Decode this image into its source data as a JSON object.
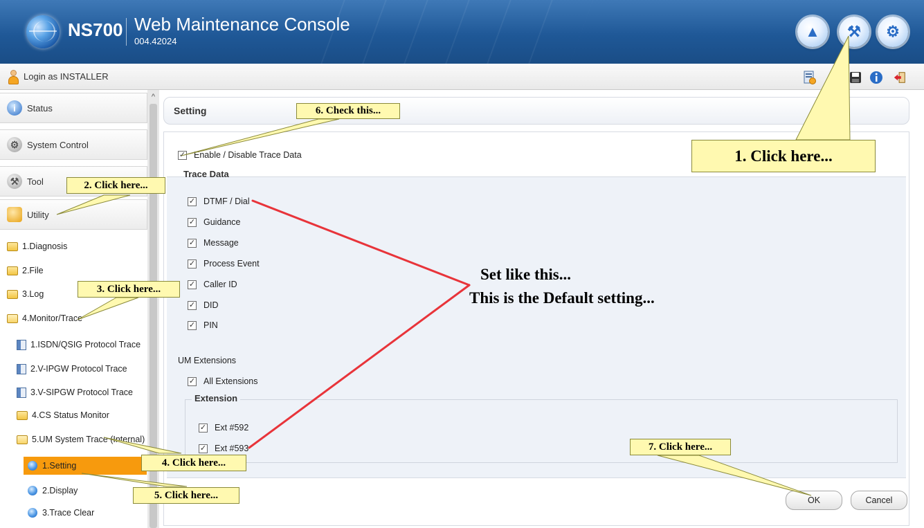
{
  "header": {
    "model": "NS700",
    "title": "Web Maintenance Console",
    "version": "004.42024",
    "buttons": [
      {
        "icon": "home-icon",
        "symbol": "▲"
      },
      {
        "icon": "wrench-icon",
        "symbol": "⚒"
      },
      {
        "icon": "gear-icon",
        "symbol": "⚙"
      }
    ]
  },
  "loginbar": {
    "login_text": "Login as INSTALLER"
  },
  "sidebar": {
    "top_items": [
      {
        "label": "Status",
        "icon": "status-icon"
      },
      {
        "label": "System Control",
        "icon": "system-control-icon"
      },
      {
        "label": "Tool",
        "icon": "tool-icon"
      },
      {
        "label": "Utility",
        "icon": "utility-icon"
      }
    ],
    "tree": [
      "1.Diagnosis",
      "2.File",
      "3.Log",
      "4.Monitor/Trace",
      "1.ISDN/QSIG Protocol Trace",
      "2.V-IPGW Protocol Trace",
      "3.V-SIPGW Protocol Trace",
      "4.CS Status Monitor",
      "5.UM System Trace (Internal)",
      "1.Setting",
      "2.Display",
      "3.Trace Clear"
    ],
    "selected_item": "1.Setting"
  },
  "main": {
    "section_title": "Setting",
    "enable_label": "Enable / Disable Trace Data",
    "enable_checked": true,
    "trace_data_title": "Trace Data",
    "trace_items": [
      {
        "label": "DTMF / Dial",
        "checked": true
      },
      {
        "label": "Guidance",
        "checked": true
      },
      {
        "label": "Message",
        "checked": true
      },
      {
        "label": "Process Event",
        "checked": true
      },
      {
        "label": "Caller ID",
        "checked": true
      },
      {
        "label": "DID",
        "checked": true
      },
      {
        "label": "PIN",
        "checked": true
      }
    ],
    "um_extensions_title": "UM Extensions",
    "all_extensions": {
      "label": "All Extensions",
      "checked": true
    },
    "extension_legend": "Extension",
    "extensions": [
      {
        "label": "Ext #592",
        "checked": true
      },
      {
        "label": "Ext #593",
        "checked": true
      }
    ],
    "ok_label": "OK",
    "cancel_label": "Cancel"
  },
  "annotations": {
    "step1": "1. Click here...",
    "step2": "2. Click here...",
    "step3": "3. Click here...",
    "step4": "4. Click here...",
    "step5": "5. Click here...",
    "step6": "6. Check this...",
    "step7": "7. Click here...",
    "note_line1": "Set like this...",
    "note_line2": "This is the Default setting...",
    "callout_color": "#fff9b0",
    "arrow_color": "#e8343a"
  }
}
